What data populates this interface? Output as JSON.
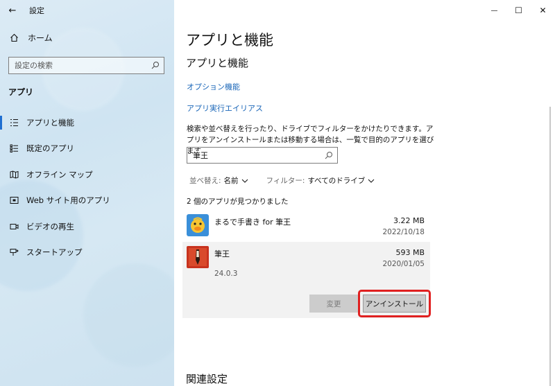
{
  "window": {
    "title": "設定",
    "back_icon": "←",
    "minimize_icon": "—",
    "maximize_icon": "☐",
    "close_icon": "✕"
  },
  "sidebar": {
    "home_label": "ホーム",
    "search_placeholder": "設定の検索",
    "section_label": "アプリ",
    "items": [
      {
        "label": "アプリと機能",
        "icon": "apps-features-icon",
        "active": true
      },
      {
        "label": "既定のアプリ",
        "icon": "default-apps-icon",
        "active": false
      },
      {
        "label": "オフライン マップ",
        "icon": "offline-maps-icon",
        "active": false
      },
      {
        "label": "Web サイト用のアプリ",
        "icon": "apps-for-websites-icon",
        "active": false
      },
      {
        "label": "ビデオの再生",
        "icon": "video-playback-icon",
        "active": false
      },
      {
        "label": "スタートアップ",
        "icon": "startup-icon",
        "active": false
      }
    ]
  },
  "main": {
    "page_title": "アプリと機能",
    "sub_title": "アプリと機能",
    "link_optional_features": "オプション機能",
    "link_app_aliases": "アプリ実行エイリアス",
    "description": "検索や並べ替えを行ったり、ドライブでフィルターをかけたりできます。アプリをアンインストールまたは移動する場合は、一覧で目的のアプリを選びます。",
    "search_value": "筆王",
    "sort_label": "並べ替え:",
    "sort_value": "名前",
    "filter_label": "フィルター:",
    "filter_value": "すべてのドライブ",
    "found_text": "2 個のアプリが見つかりました",
    "apps": [
      {
        "name": "まるで手書き for 筆王",
        "size": "3.22 MB",
        "date": "2022/10/18"
      },
      {
        "name": "筆王",
        "size": "593 MB",
        "date": "2020/01/05",
        "version": "24.0.3"
      }
    ],
    "modify_button": "変更",
    "uninstall_button": "アンインストール",
    "related_settings": "関連設定"
  },
  "colors": {
    "accent": "#1f6fd1",
    "link": "#1a66b8",
    "highlight": "#e02020"
  }
}
